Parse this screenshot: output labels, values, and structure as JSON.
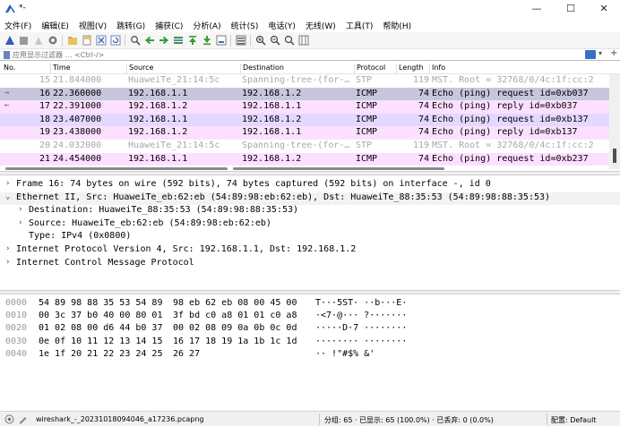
{
  "window": {
    "title": "*-",
    "min": "—",
    "max": "☐",
    "close": "✕"
  },
  "menu": [
    "文件(F)",
    "编辑(E)",
    "视图(V)",
    "跳转(G)",
    "捕获(C)",
    "分析(A)",
    "统计(S)",
    "电话(Y)",
    "无线(W)",
    "工具(T)",
    "帮助(H)"
  ],
  "toolbar": {
    "icons": [
      "shark-fin-start-icon",
      "stop-capture-icon",
      "restart-capture-icon",
      "capture-options-icon",
      "open-file-icon",
      "save-file-icon",
      "close-file-icon",
      "reload-icon",
      "find-packet-icon",
      "go-back-icon",
      "go-forward-icon",
      "go-to-packet-icon",
      "go-first-icon",
      "go-last-icon",
      "auto-scroll-icon",
      "colorize-icon",
      "zoom-in-icon",
      "zoom-out-icon",
      "zoom-normal-icon",
      "resize-columns-icon"
    ]
  },
  "filter": {
    "placeholder": "应用显示过滤器 … <Ctrl-/>"
  },
  "packet_list": {
    "headers": [
      "No.",
      "Time",
      "Source",
      "Destination",
      "Protocol",
      "Length",
      "Info"
    ],
    "rows": [
      {
        "no": "15",
        "time": "21.844000",
        "src": "HuaweiTe_21:14:5c",
        "dst": "Spanning-tree-(for-…",
        "proto": "STP",
        "len": "119",
        "info": "MST. Root = 32768/0/4c:1f:cc:2",
        "bg": "#ffffff",
        "fg": "#a8a8a8",
        "indicator": ""
      },
      {
        "no": "16",
        "time": "22.360000",
        "src": "192.168.1.1",
        "dst": "192.168.1.2",
        "proto": "ICMP",
        "len": "74",
        "info": "Echo (ping) request  id=0xb037",
        "bg": "#c6c6dc",
        "fg": "#000000",
        "indicator": "→"
      },
      {
        "no": "17",
        "time": "22.391000",
        "src": "192.168.1.2",
        "dst": "192.168.1.1",
        "proto": "ICMP",
        "len": "74",
        "info": "Echo (ping) reply    id=0xb037",
        "bg": "#fce0ff",
        "fg": "#000000",
        "indicator": "←"
      },
      {
        "no": "18",
        "time": "23.407000",
        "src": "192.168.1.1",
        "dst": "192.168.1.2",
        "proto": "ICMP",
        "len": "74",
        "info": "Echo (ping) request  id=0xb137",
        "bg": "#e3d8ff",
        "fg": "#000000",
        "indicator": ""
      },
      {
        "no": "19",
        "time": "23.438000",
        "src": "192.168.1.2",
        "dst": "192.168.1.1",
        "proto": "ICMP",
        "len": "74",
        "info": "Echo (ping) reply    id=0xb137",
        "bg": "#fce0ff",
        "fg": "#000000",
        "indicator": ""
      },
      {
        "no": "20",
        "time": "24.032000",
        "src": "HuaweiTe_21:14:5c",
        "dst": "Spanning-tree-(for-…",
        "proto": "STP",
        "len": "119",
        "info": "MST. Root = 32768/0/4c:1f:cc:2",
        "bg": "#ffffff",
        "fg": "#a8a8a8",
        "indicator": ""
      },
      {
        "no": "21",
        "time": "24.454000",
        "src": "192.168.1.1",
        "dst": "192.168.1.2",
        "proto": "ICMP",
        "len": "74",
        "info": "Echo (ping) request  id=0xb237",
        "bg": "#fce0ff",
        "fg": "#000000",
        "indicator": ""
      }
    ]
  },
  "details": [
    {
      "arrow": "›",
      "indent": 0,
      "text": "Frame 16: 74 bytes on wire (592 bits), 74 bytes captured (592 bits) on interface -, id 0",
      "highlight": false
    },
    {
      "arrow": "⌄",
      "indent": 0,
      "text": "Ethernet II, Src: HuaweiTe_eb:62:eb (54:89:98:eb:62:eb), Dst: HuaweiTe_88:35:53 (54:89:98:88:35:53)",
      "highlight": true
    },
    {
      "arrow": "›",
      "indent": 1,
      "text": "Destination: HuaweiTe_88:35:53 (54:89:98:88:35:53)",
      "highlight": false
    },
    {
      "arrow": "›",
      "indent": 1,
      "text": "Source: HuaweiTe_eb:62:eb (54:89:98:eb:62:eb)",
      "highlight": false
    },
    {
      "arrow": "",
      "indent": 1,
      "text": "Type: IPv4 (0x0800)",
      "highlight": false
    },
    {
      "arrow": "›",
      "indent": 0,
      "text": "Internet Protocol Version 4, Src: 192.168.1.1, Dst: 192.168.1.2",
      "highlight": false
    },
    {
      "arrow": "›",
      "indent": 0,
      "text": "Internet Control Message Protocol",
      "highlight": false
    }
  ],
  "bytes": [
    {
      "offset": "0000",
      "hex1": "54 89 98 88 35 53 54 89",
      "hex2": "98 eb 62 eb 08 00 45 00",
      "ascii": "T···5ST· ··b···E·"
    },
    {
      "offset": "0010",
      "hex1": "00 3c 37 b0 40 00 80 01",
      "hex2": "3f bd c0 a8 01 01 c0 a8",
      "ascii": "·<7·@··· ?·······"
    },
    {
      "offset": "0020",
      "hex1": "01 02 08 00 d6 44 b0 37",
      "hex2": "00 02 08 09 0a 0b 0c 0d",
      "ascii": "·····D·7 ········"
    },
    {
      "offset": "0030",
      "hex1": "0e 0f 10 11 12 13 14 15",
      "hex2": "16 17 18 19 1a 1b 1c 1d",
      "ascii": "········ ········"
    },
    {
      "offset": "0040",
      "hex1": "1e 1f 20 21 22 23 24 25",
      "hex2": "26 27",
      "ascii": "·· !\"#$% &'"
    }
  ],
  "status": {
    "file": "wireshark_-_20231018094046_a17236.pcapng",
    "packets": "分组: 65 · 已显示: 65 (100.0%) · 已丢弃: 0 (0.0%)",
    "profile": "配置: Default"
  }
}
